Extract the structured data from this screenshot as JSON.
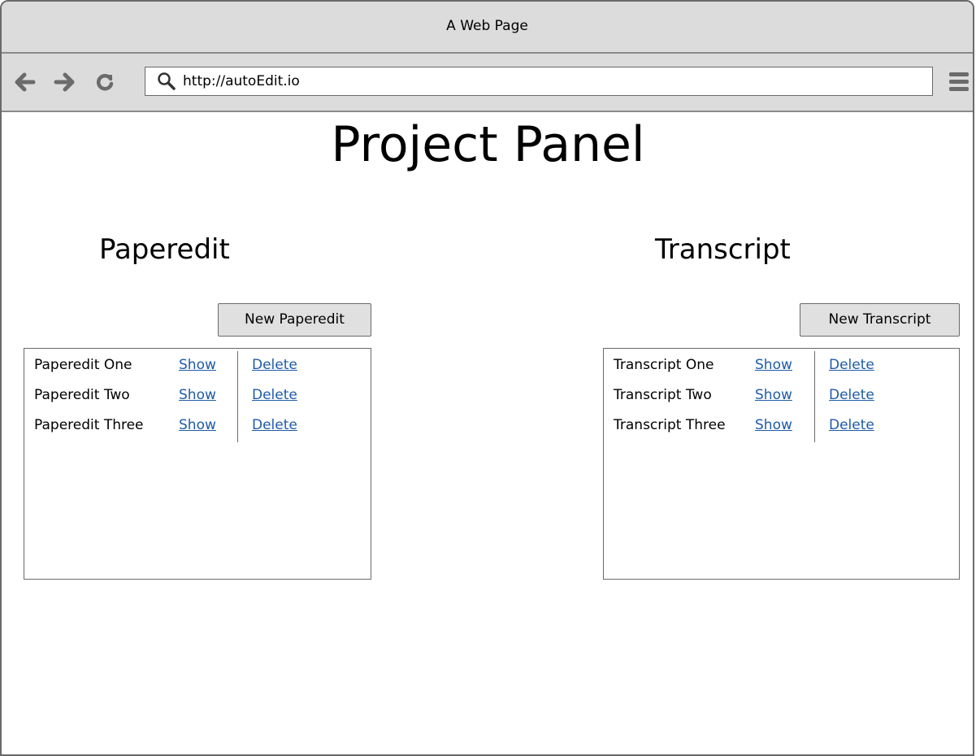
{
  "window": {
    "title": "A Web Page"
  },
  "toolbar": {
    "url": "http://autoEdit.io",
    "back_icon": "arrow-left-icon",
    "forward_icon": "arrow-right-icon",
    "reload_icon": "reload-icon",
    "menu_icon": "hamburger-menu-icon"
  },
  "page": {
    "title": "Project Panel"
  },
  "paperedit": {
    "heading": "Paperedit",
    "new_button": "New Paperedit",
    "items": [
      {
        "name": "Paperedit One",
        "show": "Show",
        "delete": "Delete"
      },
      {
        "name": "Paperedit Two",
        "show": "Show",
        "delete": "Delete"
      },
      {
        "name": "Paperedit Three",
        "show": "Show",
        "delete": "Delete"
      }
    ]
  },
  "transcript": {
    "heading": "Transcript",
    "new_button": "New Transcript",
    "items": [
      {
        "name": "Transcript One",
        "show": "Show",
        "delete": "Delete"
      },
      {
        "name": "Transcript Two",
        "show": "Show",
        "delete": "Delete"
      },
      {
        "name": "Transcript Three",
        "show": "Show",
        "delete": "Delete"
      }
    ]
  },
  "colors": {
    "link": "#1f5ba8",
    "chrome": "#dcdcdc",
    "button": "#e0e0e0"
  }
}
